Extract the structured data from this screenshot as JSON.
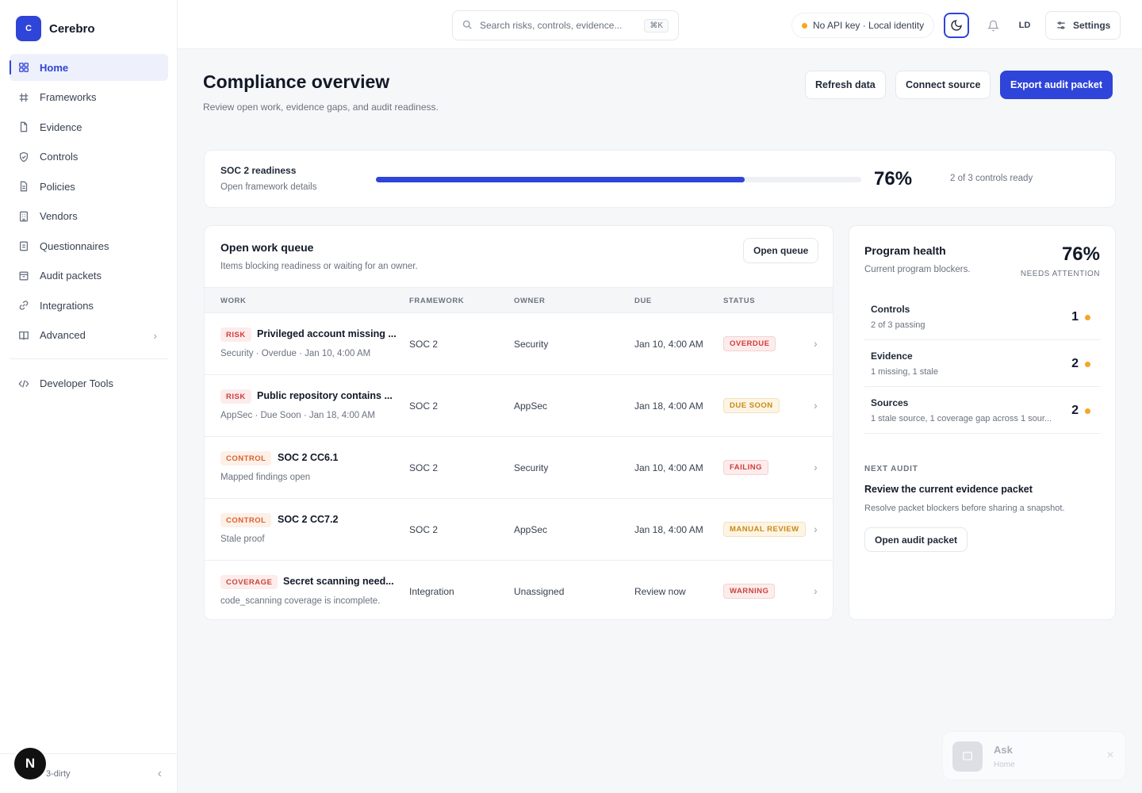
{
  "app": {
    "logo_letter": "C",
    "name": "Cerebro",
    "accent": "#2f44d8"
  },
  "sidebar": {
    "items": [
      {
        "label": "Home",
        "icon": "grid-icon",
        "active": true
      },
      {
        "label": "Frameworks",
        "icon": "hash-icon"
      },
      {
        "label": "Evidence",
        "icon": "file-icon"
      },
      {
        "label": "Controls",
        "icon": "shield-icon"
      },
      {
        "label": "Policies",
        "icon": "document-icon"
      },
      {
        "label": "Vendors",
        "icon": "building-icon"
      },
      {
        "label": "Questionnaires",
        "icon": "clipboard-icon"
      },
      {
        "label": "Audit packets",
        "icon": "package-icon"
      },
      {
        "label": "Integrations",
        "icon": "link-icon"
      },
      {
        "label": "Advanced",
        "icon": "book-icon",
        "chevron": true
      }
    ],
    "dev_tools": "Developer Tools",
    "footer_version": "3-dirty",
    "avatar_letter": "N"
  },
  "topbar": {
    "search_placeholder": "Search risks, controls, evidence...",
    "search_shortcut": "⌘K",
    "status": "No API key · Local identity",
    "user_initials": "LD",
    "settings_label": "Settings"
  },
  "page": {
    "title": "Compliance overview",
    "subtitle": "Review open work, evidence gaps, and audit readiness.",
    "buttons": {
      "refresh": "Refresh data",
      "connect": "Connect source",
      "export": "Export audit packet"
    }
  },
  "readiness": {
    "label": "SOC 2 readiness",
    "link": "Open framework details",
    "progress": 0.76,
    "percent_text": "76%",
    "count_text": "2 of 3 controls ready"
  },
  "queue": {
    "title": "Open work queue",
    "subtitle": "Items blocking readiness or waiting for an owner.",
    "open_button": "Open queue",
    "headers": {
      "work": "WORK",
      "framework": "FRAMEWORK",
      "owner": "OWNER",
      "due": "DUE",
      "status": "STATUS"
    },
    "rows": [
      {
        "tag": "RISK",
        "tag_type": "risk",
        "name": "Privileged account missing ...",
        "meta": "Security · Overdue · Jan 10, 4:00 AM",
        "framework": "SOC 2",
        "owner": "Security",
        "due": "Jan 10, 4:00 AM",
        "status": "OVERDUE",
        "status_type": "overdue"
      },
      {
        "tag": "RISK",
        "tag_type": "risk",
        "name": "Public repository contains ...",
        "meta": "AppSec · Due Soon · Jan 18, 4:00 AM",
        "framework": "SOC 2",
        "owner": "AppSec",
        "due": "Jan 18, 4:00 AM",
        "status": "DUE SOON",
        "status_type": "duesoon"
      },
      {
        "tag": "CONTROL",
        "tag_type": "control",
        "name": "SOC 2 CC6.1",
        "meta": "Mapped findings open",
        "framework": "SOC 2",
        "owner": "Security",
        "due": "Jan 10, 4:00 AM",
        "status": "FAILING",
        "status_type": "failing"
      },
      {
        "tag": "CONTROL",
        "tag_type": "control",
        "name": "SOC 2 CC7.2",
        "meta": "Stale proof",
        "framework": "SOC 2",
        "owner": "AppSec",
        "due": "Jan 18, 4:00 AM",
        "status": "MANUAL REVIEW",
        "status_type": "manual"
      },
      {
        "tag": "COVERAGE",
        "tag_type": "coverage",
        "name": "Secret scanning need...",
        "meta": "code_scanning coverage is incomplete.",
        "framework": "Integration",
        "owner": "Unassigned",
        "due": "Review now",
        "status": "WARNING",
        "status_type": "warning"
      }
    ]
  },
  "health": {
    "title": "Program health",
    "subtitle": "Current program blockers.",
    "percent_text": "76%",
    "attention": "NEEDS ATTENTION",
    "items": [
      {
        "name": "Controls",
        "desc": "2 of 3 passing",
        "count": "1"
      },
      {
        "name": "Evidence",
        "desc": "1 missing, 1 stale",
        "count": "2"
      },
      {
        "name": "Sources",
        "desc": "1 stale source, 1 coverage gap across 1 sour...",
        "count": "2"
      }
    ],
    "next_audit_label": "NEXT AUDIT",
    "next_audit_title": "Review the current evidence packet",
    "next_audit_sub": "Resolve packet blockers before sharing a snapshot.",
    "next_audit_button": "Open audit packet"
  },
  "ask": {
    "title": "Ask",
    "subtitle": "Home"
  }
}
